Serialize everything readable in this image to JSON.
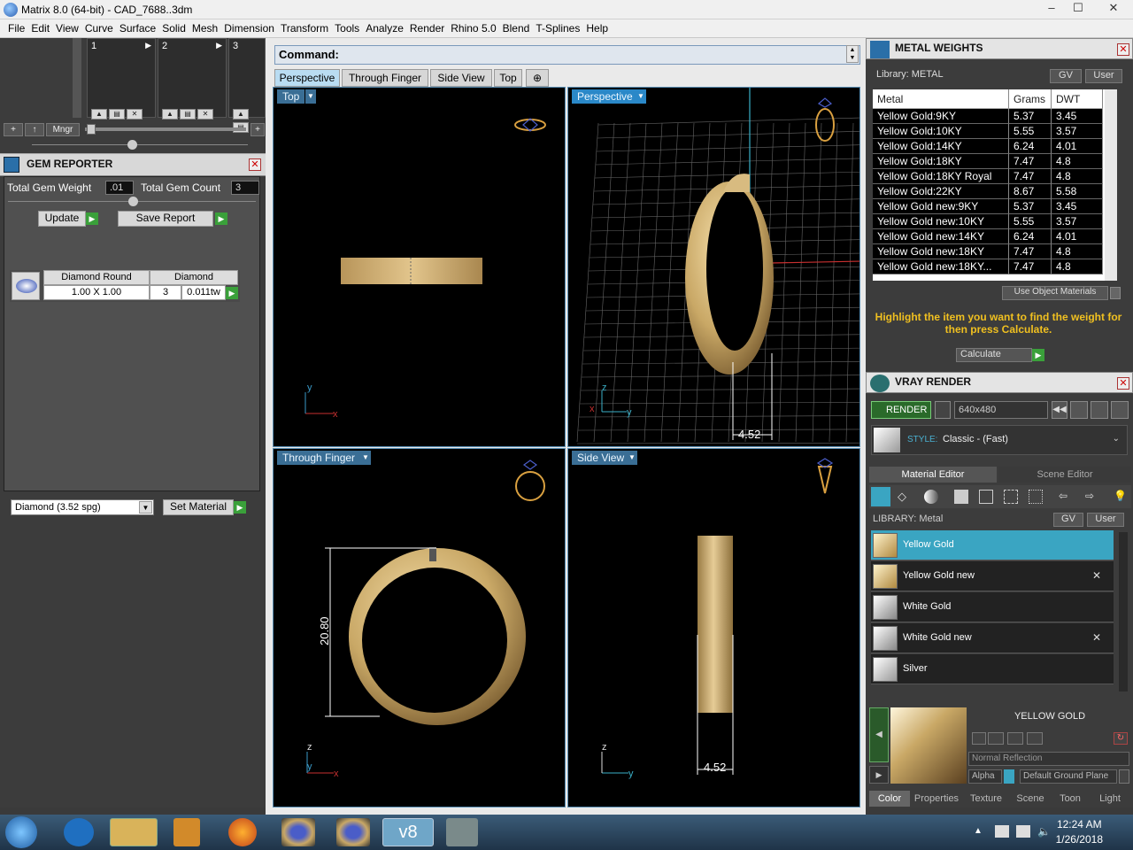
{
  "window": {
    "title": "Matrix 8.0 (64-bit) - CAD_7688..3dm",
    "controls": {
      "minimize": "–",
      "maximize": "☐",
      "close": "✕"
    }
  },
  "menu": [
    "File",
    "Edit",
    "View",
    "Curve",
    "Surface",
    "Solid",
    "Mesh",
    "Dimension",
    "Transform",
    "Tools",
    "Analyze",
    "Render",
    "Rhino 5.0",
    "Blend",
    "T-Splines",
    "Help"
  ],
  "layers": {
    "slots": [
      "1",
      "2",
      "3"
    ],
    "add_label": "+",
    "up_label": "↑",
    "mngr_label": "Mngr"
  },
  "gem_reporter": {
    "title": "GEM REPORTER",
    "total_weight_label": "Total Gem Weight",
    "total_weight_value": ".01",
    "total_count_label": "Total Gem Count",
    "total_count_value": "3",
    "update_label": "Update",
    "save_report_label": "Save Report",
    "table": {
      "headers": [
        "Diamond Round",
        "Diamond"
      ],
      "row": {
        "size": "1.00 X 1.00",
        "count": "3",
        "weight": "0.011tw"
      }
    },
    "material_select": "Diamond    (3.52 spg)",
    "set_material_label": "Set Material"
  },
  "command": {
    "label": "Command:"
  },
  "view_tabs": [
    {
      "label": "Perspective",
      "active": true
    },
    {
      "label": "Through Finger",
      "active": false
    },
    {
      "label": "Side View",
      "active": false
    },
    {
      "label": "Top",
      "active": false
    },
    {
      "label": "⊕",
      "active": false
    }
  ],
  "viewports": {
    "top": {
      "label": "Top"
    },
    "perspective": {
      "label": "Perspective",
      "dimension": "4.52"
    },
    "through_finger": {
      "label": "Through Finger",
      "dimension": "20.80"
    },
    "side_view": {
      "label": "Side View",
      "dimension": "4.52"
    }
  },
  "axes": {
    "x": "x",
    "y": "y",
    "z": "z"
  },
  "metal_weights": {
    "title": "METAL WEIGHTS",
    "library_label": "Library: METAL",
    "gv_label": "GV",
    "user_label": "User",
    "headers": [
      "Metal",
      "Grams",
      "DWT"
    ],
    "rows": [
      [
        "Yellow Gold:9KY",
        "5.37",
        "3.45"
      ],
      [
        "Yellow Gold:10KY",
        "5.55",
        "3.57"
      ],
      [
        "Yellow Gold:14KY",
        "6.24",
        "4.01"
      ],
      [
        "Yellow Gold:18KY",
        "7.47",
        "4.8"
      ],
      [
        "Yellow Gold:18KY Royal",
        "7.47",
        "4.8"
      ],
      [
        "Yellow Gold:22KY",
        "8.67",
        "5.58"
      ],
      [
        "Yellow Gold new:9KY",
        "5.37",
        "3.45"
      ],
      [
        "Yellow Gold new:10KY",
        "5.55",
        "3.57"
      ],
      [
        "Yellow Gold new:14KY",
        "6.24",
        "4.01"
      ],
      [
        "Yellow Gold new:18KY",
        "7.47",
        "4.8"
      ],
      [
        "Yellow Gold new:18KY...",
        "7.47",
        "4.8"
      ]
    ],
    "use_object_materials": "Use Object Materials",
    "hint": "Highlight the item you want to find the weight for then press Calculate.",
    "calculate_label": "Calculate"
  },
  "vray": {
    "title": "VRAY RENDER",
    "render_label": "RENDER",
    "resolution": "640x480",
    "style_label": "STYLE:",
    "style_value": "Classic - (Fast)"
  },
  "material_editor": {
    "tab_material": "Material Editor",
    "tab_scene": "Scene Editor",
    "library_label": "LIBRARY: Metal",
    "gv_label": "GV",
    "user_label": "User",
    "materials": [
      {
        "name": "Yellow Gold",
        "selected": true,
        "removable": false
      },
      {
        "name": "Yellow Gold new",
        "selected": false,
        "removable": true
      },
      {
        "name": "White Gold",
        "selected": false,
        "removable": false
      },
      {
        "name": "White Gold new",
        "selected": false,
        "removable": true
      },
      {
        "name": "Silver",
        "selected": false,
        "removable": false
      }
    ],
    "preview_title": "YELLOW GOLD",
    "reflection": "Normal Reflection",
    "alpha_label": "Alpha",
    "ground_plane": "Default Ground Plane",
    "bottom_tabs": [
      "Color",
      "Properties",
      "Texture",
      "Scene",
      "Toon",
      "Light"
    ]
  },
  "taskbar": {
    "time": "12:24 AM",
    "date": "1/26/2018",
    "v8_label": "v8"
  },
  "colors": {
    "accent": "#3aa5c2",
    "gold": "#c8a868",
    "hint": "#f0c020",
    "grid": "#666666"
  }
}
